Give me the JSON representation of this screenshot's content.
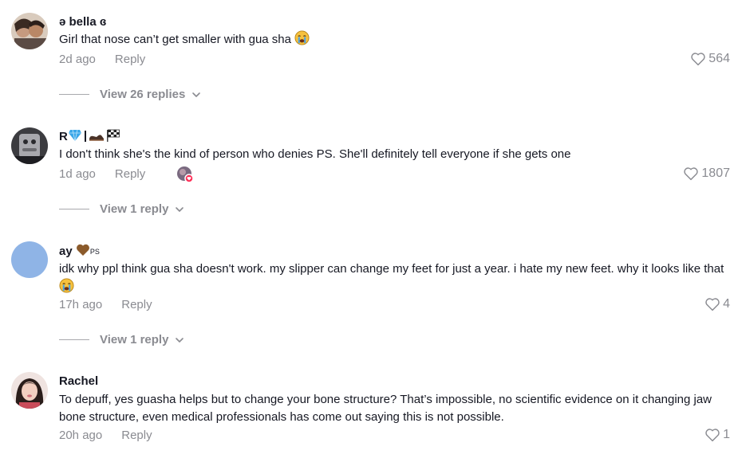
{
  "comments": [
    {
      "username": "ə bella ɞ",
      "text": "Girl that nose can’t get smaller with gua sha",
      "time": "2d ago",
      "reply_label": "Reply",
      "likes": "564",
      "view_replies": "View 26 replies"
    },
    {
      "username": "R",
      "text": "I don't think she's the kind of person who denies PS. She'll definitely tell everyone if she gets one",
      "time": "1d ago",
      "reply_label": "Reply",
      "likes": "1807",
      "view_replies": "View 1 reply"
    },
    {
      "username": "ay",
      "username_suffix": "PS",
      "text": "idk why ppl think gua sha doesn't work. my slipper can change my feet for just a year. i hate my new feet. why it looks like that",
      "time": "17h ago",
      "reply_label": "Reply",
      "likes": "4",
      "view_replies": "View 1 reply"
    },
    {
      "username": "Rachel",
      "text": "To depuff, yes guasha helps but to change your bone structure? That’s impossible, no scientific evidence on it changing jaw bone structure, even medical professionals has come out saying this is not possible.",
      "time": "20h ago",
      "reply_label": "Reply",
      "likes": "1"
    }
  ],
  "colors": {
    "text": "#161823",
    "muted": "#8a8b91",
    "avatar_blue": "#8fb4e6"
  },
  "icons": [
    "heart-icon",
    "chevron-down-icon",
    "crying-emoji-icon",
    "diamond-icon",
    "flag-icon",
    "heart-brown-icon"
  ]
}
